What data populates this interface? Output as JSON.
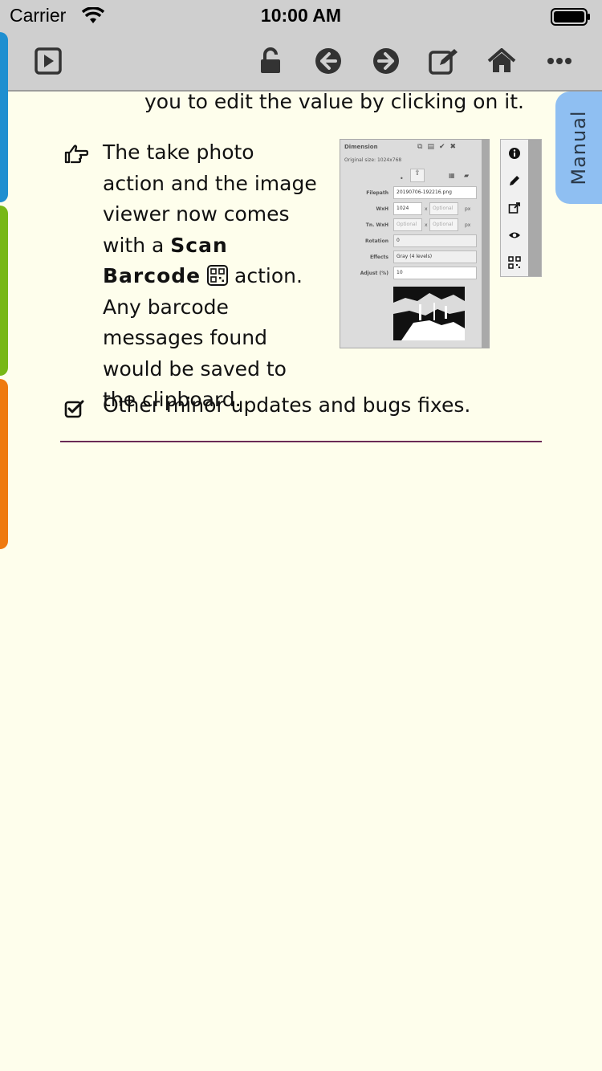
{
  "status_bar": {
    "carrier": "Carrier",
    "time": "10:00 AM"
  },
  "toolbar": {
    "icons": [
      "play-square-icon",
      "unlock-icon",
      "back-arrow-icon",
      "forward-arrow-icon",
      "edit-icon",
      "home-icon",
      "more-icon"
    ]
  },
  "side_tab": {
    "label": "Manual"
  },
  "content": {
    "top_line": "you to edit the value by clicking on it.",
    "bullet1_a": "The take photo action and the image viewer now comes with a",
    "bullet1_bold": "Scan Barcode",
    "bullet1_b": "action. Any barcode messages found would be saved to the clipboard.",
    "bullet2": "Other minor updates and bugs fixes."
  },
  "embedded_screenshot": {
    "title": "Dimension",
    "original_size": "Original size: 1024x768",
    "filepath_label": "Filepath",
    "filepath_value": "20190706-192216.png",
    "wxh_label": "WxH",
    "wxh_w": "1024",
    "x": "x",
    "optional": "Optional",
    "px": "px",
    "tn_wxh_label": "Tn. WxH",
    "rotation_label": "Rotation",
    "rotation_value": "0",
    "effects_label": "Effects",
    "effects_value": "Gray (4 levels)",
    "adjust_label": "Adjust (%)",
    "adjust_value": "10"
  },
  "colors": {
    "background": "#fefeec",
    "tab_blue": "#1f8fd0",
    "tab_green": "#77b816",
    "tab_orange": "#ef7a10",
    "manual_tab": "#8fbff2",
    "divider": "#6a2a55"
  }
}
